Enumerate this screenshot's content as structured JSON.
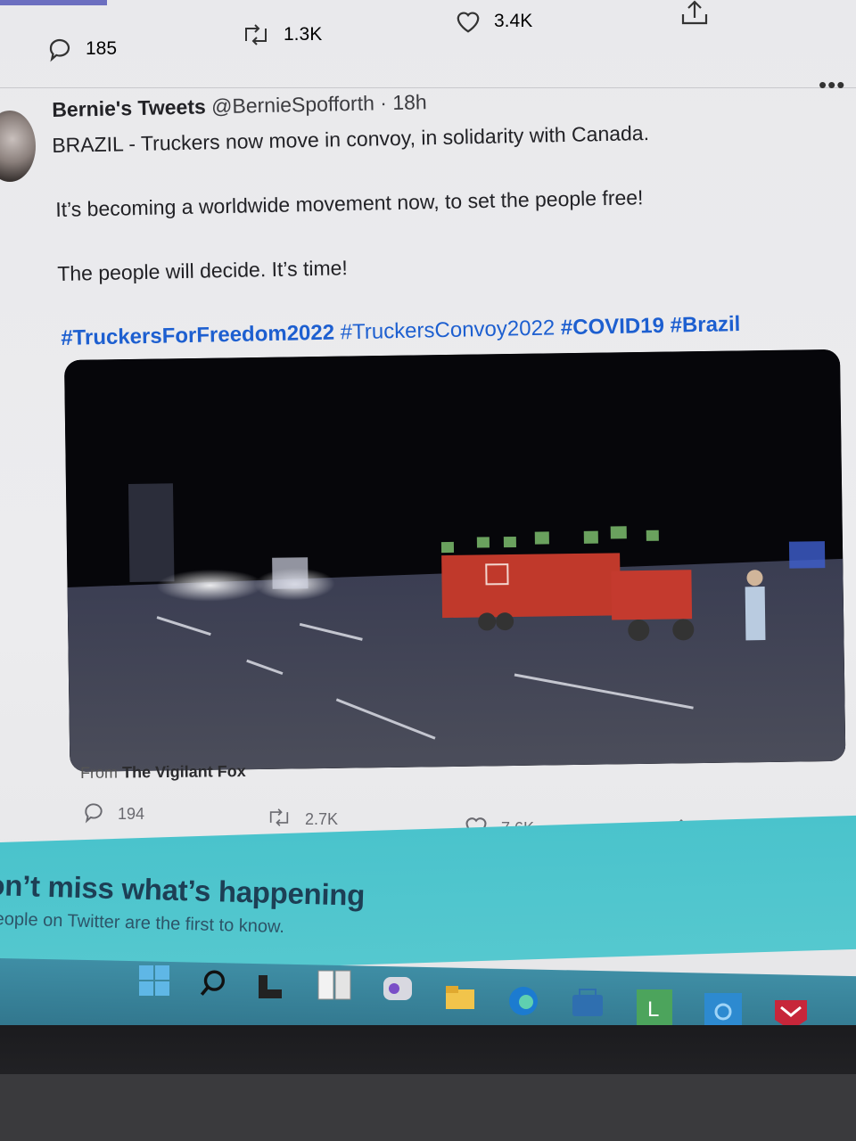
{
  "prev_tweet": {
    "replies": "185",
    "retweets": "1.3K",
    "likes": "3.4K"
  },
  "tweet": {
    "author": "Bernie's Tweets",
    "handle": "@BernieSpofforth",
    "time": "18h",
    "line1": "BRAZIL - Truckers now move in convoy, in solidarity with Canada.",
    "line2": "It’s becoming a worldwide movement now, to set the people free!",
    "line3": "The people will decide. It’s time!",
    "hashtags": {
      "h1": "#TruckersForFreedom2022",
      "h2": "#TruckersConvoy2022",
      "h3": "#COVID19",
      "h4": "#Brazil"
    },
    "media_from_label": "From",
    "media_source": "The Vigilant Fox",
    "replies": "194",
    "retweets": "2.7K",
    "likes": "7.6K"
  },
  "banner": {
    "title": "on’t miss what’s happening",
    "subtitle": "eople on Twitter are the first to know."
  },
  "icons": {
    "more": "more-icon",
    "reply": "reply-icon",
    "retweet": "retweet-icon",
    "like": "heart-icon",
    "share": "share-icon"
  },
  "colors": {
    "hashtag": "#1d5fd0",
    "banner": "#4ac3cc",
    "taskbar": "#3f8ea5"
  }
}
